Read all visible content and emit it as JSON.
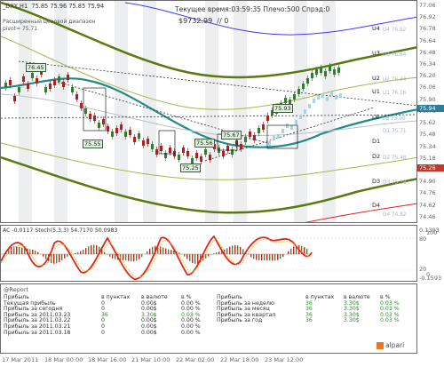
{
  "header": {
    "symbol": "_DXY,H1",
    "ohlc": "75.85 75.96 75.85 75.94",
    "time_label": "Текущее время:",
    "time_value": "03:59:35",
    "leverage_label": "Плечо:",
    "leverage_value": "500",
    "spread_label": "Спрэд:",
    "spread_value": "0",
    "balance": "$9732.99",
    "balance_suffix": "// 0",
    "diagram_line1": "Расширенный ценовой диапазон",
    "diagram_line2": "pivot= 75.71"
  },
  "main_scale": {
    "ticks": [
      "77.06",
      "76.92",
      "76.78",
      "76.64",
      "76.48",
      "76.34",
      "76.20",
      "76.06",
      "75.90",
      "75.76",
      "75.62",
      "75.48",
      "75.34",
      "75.18",
      "75.04",
      "74.90",
      "74.76",
      "74.62",
      "74.46"
    ],
    "current_price": "75.94",
    "red_price": "75.26"
  },
  "levels": {
    "U4": "U4",
    "U3": "U3",
    "U2": "U2",
    "U1": "U1",
    "LB": "LB",
    "D1": "D1",
    "D2": "D2",
    "D3": "D3",
    "D4": "D4"
  },
  "level_values": {
    "u4": "U4 76.92",
    "u3": "U3 76.64",
    "u2": "U2 76.34",
    "u1": "U1 76.16",
    "lb": "LB 75.90",
    "d1": "D1 75.71",
    "d2": "D2 75.48",
    "d3": "D3 75.18",
    "d4": "D4 74.82"
  },
  "bubbles": {
    "b1": "76.45",
    "b2": "75.55",
    "b3": "75.25",
    "b4": "75.56",
    "b5": "75.67",
    "b6": "75.93"
  },
  "oscillator": {
    "header": "AC -0.0117  Stoch(5,3,3) 54.7170 50.0983",
    "scale_100": "100",
    "scale_80": "80",
    "scale_20": "20",
    "scale_0": "0",
    "scale_top": "0.1393",
    "scale_bottom": "-0.1593"
  },
  "report": {
    "title": "@Report",
    "left_headers": [
      "Прибыль",
      "в пунктах",
      "в валюте",
      "в %"
    ],
    "left_rows": [
      [
        "Текущая прибыль",
        "0",
        "0.00$",
        "0.00 %"
      ],
      [
        "Прибыль за сегодня",
        "0",
        "0.00$",
        "0.00 %"
      ],
      [
        "Прибыль за 2011.03.23",
        "36",
        "3.30$",
        "0.03 %"
      ],
      [
        "Прибыль за 2011.03.22",
        "0",
        "0.00$",
        "0.00 %"
      ],
      [
        "Прибыль за 2011.03.21",
        "0",
        "0.00$",
        "0.00 %"
      ],
      [
        "Прибыль за 2011.03.18",
        "0",
        "0.00$",
        "0.00 %"
      ]
    ],
    "right_headers": [
      "Прибыль",
      "в пунктах",
      "в валюте",
      "в %"
    ],
    "right_rows": [
      [
        "Прибыль за неделю",
        "36",
        "3.30$",
        "0.03 %"
      ],
      [
        "Прибыль за месяц",
        "36",
        "3.30$",
        "0.03 %"
      ],
      [
        "Прибыль за квартал",
        "36",
        "3.30$",
        "0.03 %"
      ],
      [
        "Прибыль за год",
        "36",
        "3.30$",
        "0.03 %"
      ]
    ],
    "logo": "alpari"
  },
  "time_axis": [
    "17 Mar 2011",
    "18 Mar 00:00",
    "18 Mar 16:00",
    "21 Mar 10:00",
    "22 Mar 02:00",
    "22 Mar 18:00",
    "23 Mar 12:00"
  ],
  "colors": {
    "bull_candle": "#2f7f2f",
    "bear_candle": "#b02020",
    "teal_ma": "#1f8a8a",
    "olive_band": "#6f8f1f",
    "current_price_box": "#2e7d9a",
    "red_price_box": "#c0392b"
  }
}
